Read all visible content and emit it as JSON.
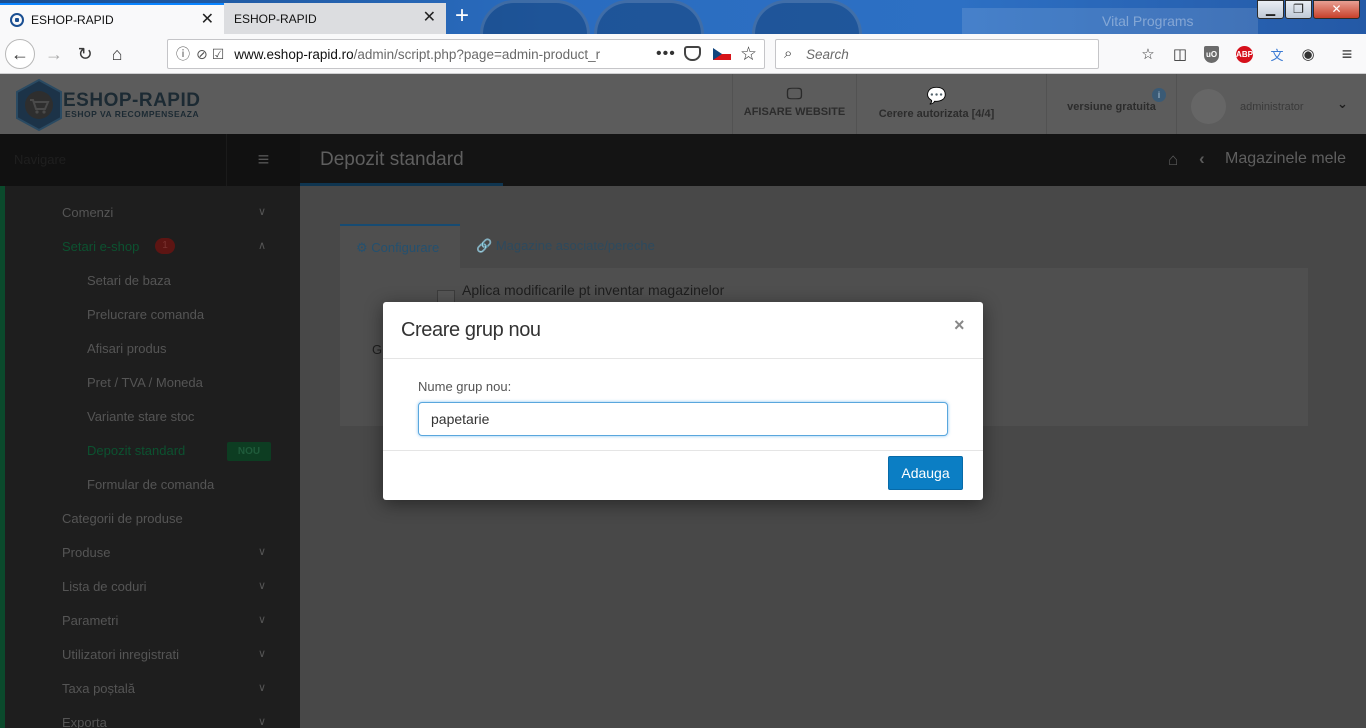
{
  "browser": {
    "tabs": [
      {
        "title": "ESHOP-RAPID",
        "active": true
      },
      {
        "title": "ESHOP-RAPID",
        "active": false
      }
    ],
    "url_domain": "www.eshop-rapid.ro",
    "url_path": "/admin/script.php?page=admin-product_r",
    "search_placeholder": "Search",
    "background_banner_text": "Vital Programs"
  },
  "header": {
    "logo_title": "ESHOP-RAPID",
    "logo_tagline": "ESHOP VA RECOMPENSEAZA",
    "items": [
      {
        "label": "AFISARE WEBSITE",
        "icon": "monitor-icon"
      },
      {
        "label": "Cerere autorizata [4/4]",
        "icon": "chat-bubbles-icon"
      }
    ],
    "version_label": "versiune gratuita",
    "info_glyph": "i",
    "user_label": "administrator"
  },
  "sidebar": {
    "nav_label": "Navigare",
    "items": [
      {
        "label": "Comenzi",
        "expandable": true
      },
      {
        "label": "Setari e-shop",
        "expandable": true,
        "expanded": true,
        "badge": "1"
      },
      {
        "label": "Setari de baza",
        "sub": true
      },
      {
        "label": "Prelucrare comanda",
        "sub": true
      },
      {
        "label": "Afisari produs",
        "sub": true
      },
      {
        "label": "Pret / TVA / Moneda",
        "sub": true
      },
      {
        "label": "Variante stare stoc",
        "sub": true
      },
      {
        "label": "Depozit standard",
        "sub": true,
        "active": true,
        "badge": "NOU"
      },
      {
        "label": "Formular de comanda",
        "sub": true
      },
      {
        "label": "Categorii de produse"
      },
      {
        "label": "Produse",
        "expandable": true
      },
      {
        "label": "Lista de coduri",
        "expandable": true
      },
      {
        "label": "Parametri",
        "expandable": true
      },
      {
        "label": "Utilizatori inregistrati",
        "expandable": true
      },
      {
        "label": "Taxa poștală",
        "expandable": true
      },
      {
        "label": "Exporta",
        "expandable": true
      }
    ]
  },
  "page": {
    "title": "Depozit standard",
    "breadcrumb": "Magazinele mele",
    "tabs": [
      {
        "label": "Configurare",
        "icon": "gears-icon"
      },
      {
        "label": "Magazine asociate/pereche",
        "icon": "link-icon"
      }
    ],
    "checkbox_label": "Aplica modificarile pt inventar magazinelor",
    "partial_label": "G"
  },
  "modal": {
    "title": "Creare grup nou",
    "close_glyph": "×",
    "field_label": "Nume grup nou:",
    "field_value": "papetarie",
    "submit_label": "Adauga"
  },
  "colors": {
    "accent_blue": "#0b7ec4",
    "firefox_blue": "#0a84ff",
    "nav_green": "#0c5230"
  }
}
